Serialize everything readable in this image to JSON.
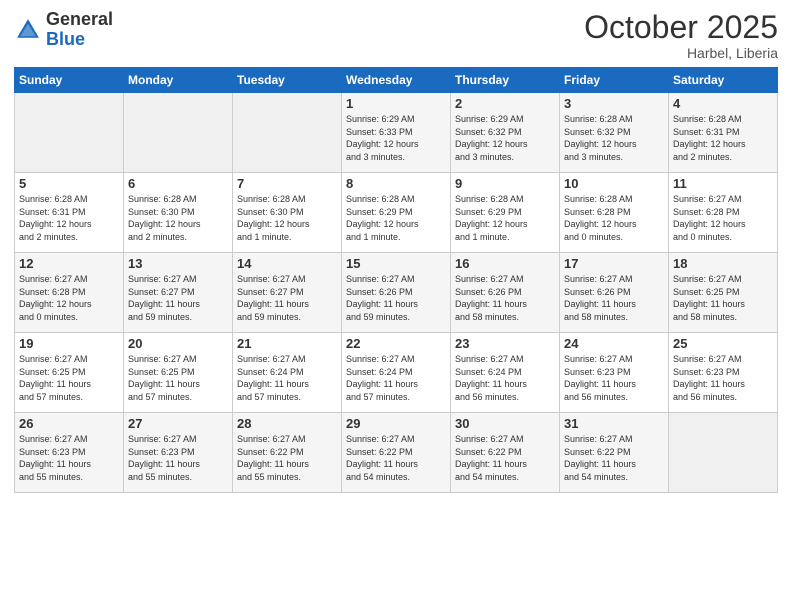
{
  "header": {
    "logo_general": "General",
    "logo_blue": "Blue",
    "month": "October 2025",
    "location": "Harbel, Liberia"
  },
  "days_of_week": [
    "Sunday",
    "Monday",
    "Tuesday",
    "Wednesday",
    "Thursday",
    "Friday",
    "Saturday"
  ],
  "weeks": [
    [
      {
        "day": "",
        "info": ""
      },
      {
        "day": "",
        "info": ""
      },
      {
        "day": "",
        "info": ""
      },
      {
        "day": "1",
        "info": "Sunrise: 6:29 AM\nSunset: 6:33 PM\nDaylight: 12 hours\nand 3 minutes."
      },
      {
        "day": "2",
        "info": "Sunrise: 6:29 AM\nSunset: 6:32 PM\nDaylight: 12 hours\nand 3 minutes."
      },
      {
        "day": "3",
        "info": "Sunrise: 6:28 AM\nSunset: 6:32 PM\nDaylight: 12 hours\nand 3 minutes."
      },
      {
        "day": "4",
        "info": "Sunrise: 6:28 AM\nSunset: 6:31 PM\nDaylight: 12 hours\nand 2 minutes."
      }
    ],
    [
      {
        "day": "5",
        "info": "Sunrise: 6:28 AM\nSunset: 6:31 PM\nDaylight: 12 hours\nand 2 minutes."
      },
      {
        "day": "6",
        "info": "Sunrise: 6:28 AM\nSunset: 6:30 PM\nDaylight: 12 hours\nand 2 minutes."
      },
      {
        "day": "7",
        "info": "Sunrise: 6:28 AM\nSunset: 6:30 PM\nDaylight: 12 hours\nand 1 minute."
      },
      {
        "day": "8",
        "info": "Sunrise: 6:28 AM\nSunset: 6:29 PM\nDaylight: 12 hours\nand 1 minute."
      },
      {
        "day": "9",
        "info": "Sunrise: 6:28 AM\nSunset: 6:29 PM\nDaylight: 12 hours\nand 1 minute."
      },
      {
        "day": "10",
        "info": "Sunrise: 6:28 AM\nSunset: 6:28 PM\nDaylight: 12 hours\nand 0 minutes."
      },
      {
        "day": "11",
        "info": "Sunrise: 6:27 AM\nSunset: 6:28 PM\nDaylight: 12 hours\nand 0 minutes."
      }
    ],
    [
      {
        "day": "12",
        "info": "Sunrise: 6:27 AM\nSunset: 6:28 PM\nDaylight: 12 hours\nand 0 minutes."
      },
      {
        "day": "13",
        "info": "Sunrise: 6:27 AM\nSunset: 6:27 PM\nDaylight: 11 hours\nand 59 minutes."
      },
      {
        "day": "14",
        "info": "Sunrise: 6:27 AM\nSunset: 6:27 PM\nDaylight: 11 hours\nand 59 minutes."
      },
      {
        "day": "15",
        "info": "Sunrise: 6:27 AM\nSunset: 6:26 PM\nDaylight: 11 hours\nand 59 minutes."
      },
      {
        "day": "16",
        "info": "Sunrise: 6:27 AM\nSunset: 6:26 PM\nDaylight: 11 hours\nand 58 minutes."
      },
      {
        "day": "17",
        "info": "Sunrise: 6:27 AM\nSunset: 6:26 PM\nDaylight: 11 hours\nand 58 minutes."
      },
      {
        "day": "18",
        "info": "Sunrise: 6:27 AM\nSunset: 6:25 PM\nDaylight: 11 hours\nand 58 minutes."
      }
    ],
    [
      {
        "day": "19",
        "info": "Sunrise: 6:27 AM\nSunset: 6:25 PM\nDaylight: 11 hours\nand 57 minutes."
      },
      {
        "day": "20",
        "info": "Sunrise: 6:27 AM\nSunset: 6:25 PM\nDaylight: 11 hours\nand 57 minutes."
      },
      {
        "day": "21",
        "info": "Sunrise: 6:27 AM\nSunset: 6:24 PM\nDaylight: 11 hours\nand 57 minutes."
      },
      {
        "day": "22",
        "info": "Sunrise: 6:27 AM\nSunset: 6:24 PM\nDaylight: 11 hours\nand 57 minutes."
      },
      {
        "day": "23",
        "info": "Sunrise: 6:27 AM\nSunset: 6:24 PM\nDaylight: 11 hours\nand 56 minutes."
      },
      {
        "day": "24",
        "info": "Sunrise: 6:27 AM\nSunset: 6:23 PM\nDaylight: 11 hours\nand 56 minutes."
      },
      {
        "day": "25",
        "info": "Sunrise: 6:27 AM\nSunset: 6:23 PM\nDaylight: 11 hours\nand 56 minutes."
      }
    ],
    [
      {
        "day": "26",
        "info": "Sunrise: 6:27 AM\nSunset: 6:23 PM\nDaylight: 11 hours\nand 55 minutes."
      },
      {
        "day": "27",
        "info": "Sunrise: 6:27 AM\nSunset: 6:23 PM\nDaylight: 11 hours\nand 55 minutes."
      },
      {
        "day": "28",
        "info": "Sunrise: 6:27 AM\nSunset: 6:22 PM\nDaylight: 11 hours\nand 55 minutes."
      },
      {
        "day": "29",
        "info": "Sunrise: 6:27 AM\nSunset: 6:22 PM\nDaylight: 11 hours\nand 54 minutes."
      },
      {
        "day": "30",
        "info": "Sunrise: 6:27 AM\nSunset: 6:22 PM\nDaylight: 11 hours\nand 54 minutes."
      },
      {
        "day": "31",
        "info": "Sunrise: 6:27 AM\nSunset: 6:22 PM\nDaylight: 11 hours\nand 54 minutes."
      },
      {
        "day": "",
        "info": ""
      }
    ]
  ]
}
